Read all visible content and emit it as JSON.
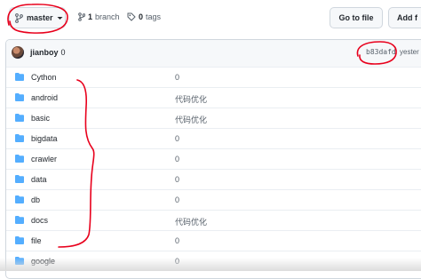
{
  "branch": {
    "label": "master",
    "icon": "git-branch-icon",
    "caret": "chevron-down-icon"
  },
  "branches": {
    "count": "1",
    "label": "branch",
    "icon": "git-branch-icon"
  },
  "tags": {
    "count": "0",
    "label": "tags",
    "icon": "tag-icon"
  },
  "actions": {
    "goto_label": "Go to file",
    "add_label": "Add f"
  },
  "commit": {
    "author": "jianboy",
    "count": "0",
    "sha": "b83dafd",
    "time": "yester"
  },
  "files": [
    {
      "name": "Cython",
      "message": "0"
    },
    {
      "name": "android",
      "message": "代码优化"
    },
    {
      "name": "basic",
      "message": "代码优化"
    },
    {
      "name": "bigdata",
      "message": "0"
    },
    {
      "name": "crawler",
      "message": "0"
    },
    {
      "name": "data",
      "message": "0"
    },
    {
      "name": "db",
      "message": "0"
    },
    {
      "name": "docs",
      "message": "代码优化"
    },
    {
      "name": "file",
      "message": "0"
    },
    {
      "name": "google",
      "message": "0"
    }
  ],
  "colors": {
    "folder": "#54aeff",
    "annotation": "#e8001c",
    "border": "#d0d7de"
  }
}
